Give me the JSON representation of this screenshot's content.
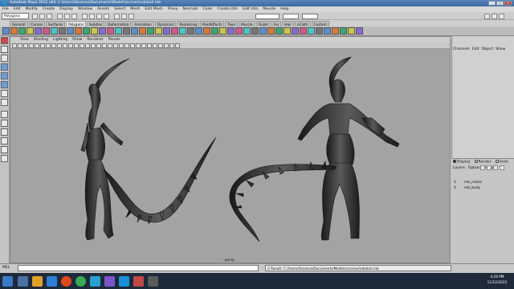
{
  "window": {
    "title": "Autodesk Maya 2012 x64: C:\\Users\\Vanessa\\Documents\\Models\\scenes\\robotail.mb"
  },
  "menubar": {
    "items": [
      "File",
      "Edit",
      "Modify",
      "Create",
      "Display",
      "Window",
      "Assets",
      "Select",
      "Mesh",
      "Edit Mesh",
      "Proxy",
      "Normals",
      "Color",
      "Create UVs",
      "Edit UVs",
      "Muscle",
      "Help"
    ]
  },
  "status": {
    "mode": "Polygons"
  },
  "shelf": {
    "tabs": [
      "General",
      "Curves",
      "Surfaces",
      "Polygons",
      "Subdivs",
      "Deformation",
      "Animation",
      "Dynamics",
      "Rendering",
      "PaintEffects",
      "Toon",
      "Muscle",
      "Fluids",
      "Fur",
      "Hair",
      "nCloth",
      "Custom"
    ],
    "active_tab": "Polygons"
  },
  "panel": {
    "menus": [
      "View",
      "Shading",
      "Lighting",
      "Show",
      "Renderer",
      "Panels"
    ],
    "camera_label": "persp"
  },
  "channelbox": {
    "tabs": [
      "Channels",
      "Edit",
      "Object",
      "Show"
    ]
  },
  "layers": {
    "tabs": [
      "Display",
      "Render",
      "Anim"
    ],
    "active_tab": "Display",
    "menus": [
      "Layers",
      "Options",
      "Help"
    ],
    "rows": [
      {
        "v": "V",
        "name": "mb_metal"
      },
      {
        "v": "V",
        "name": "mb_body"
      }
    ]
  },
  "commandline": {
    "label": "MEL",
    "result": "// Result: C:/Users/Vanessa/Documents/Models/scenes/robotail.mb"
  },
  "taskbar": {
    "time": "4:28 PM",
    "date": "11/12/2022"
  },
  "colors": {
    "viewport_bg": "#a3a3a3",
    "titlebar": "#4a78ad",
    "taskbar": "#1e2a3a",
    "model": "#2c2c2c"
  }
}
